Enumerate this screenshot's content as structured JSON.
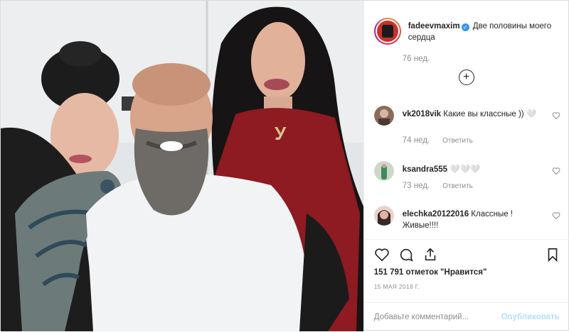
{
  "post": {
    "author": "fadeevmaxim",
    "verified_icon": "verified-badge-icon",
    "caption": "Две половины моего сердца",
    "caption_time": "76 нед."
  },
  "comments": [
    {
      "user": "vk2018vik",
      "text": "Какие вы классные )) 🤍",
      "time": "74 нед.",
      "reply": "Ответить",
      "avatar_color": "#7a5a4a"
    },
    {
      "user": "ksandra555",
      "text": "🤍🤍🤍",
      "time": "73 нед.",
      "reply": "Ответить",
      "avatar_color": "#4f8f6a"
    },
    {
      "user": "elechka20122016",
      "text": "Классные ! Живые!!!!",
      "time": "",
      "reply": "",
      "avatar_color": "#b58b7a"
    }
  ],
  "actions": {
    "likes": "151 791 отметок \"Нравится\"",
    "date": "15 МАЯ 2018 Г.",
    "comment_placeholder": "Добавьте комментарий...",
    "publish_label": "Опубликовать"
  },
  "colors": {
    "accent": "#3897f0",
    "publish_disabled": "#b2dffc",
    "muted": "#8e8e8e"
  }
}
